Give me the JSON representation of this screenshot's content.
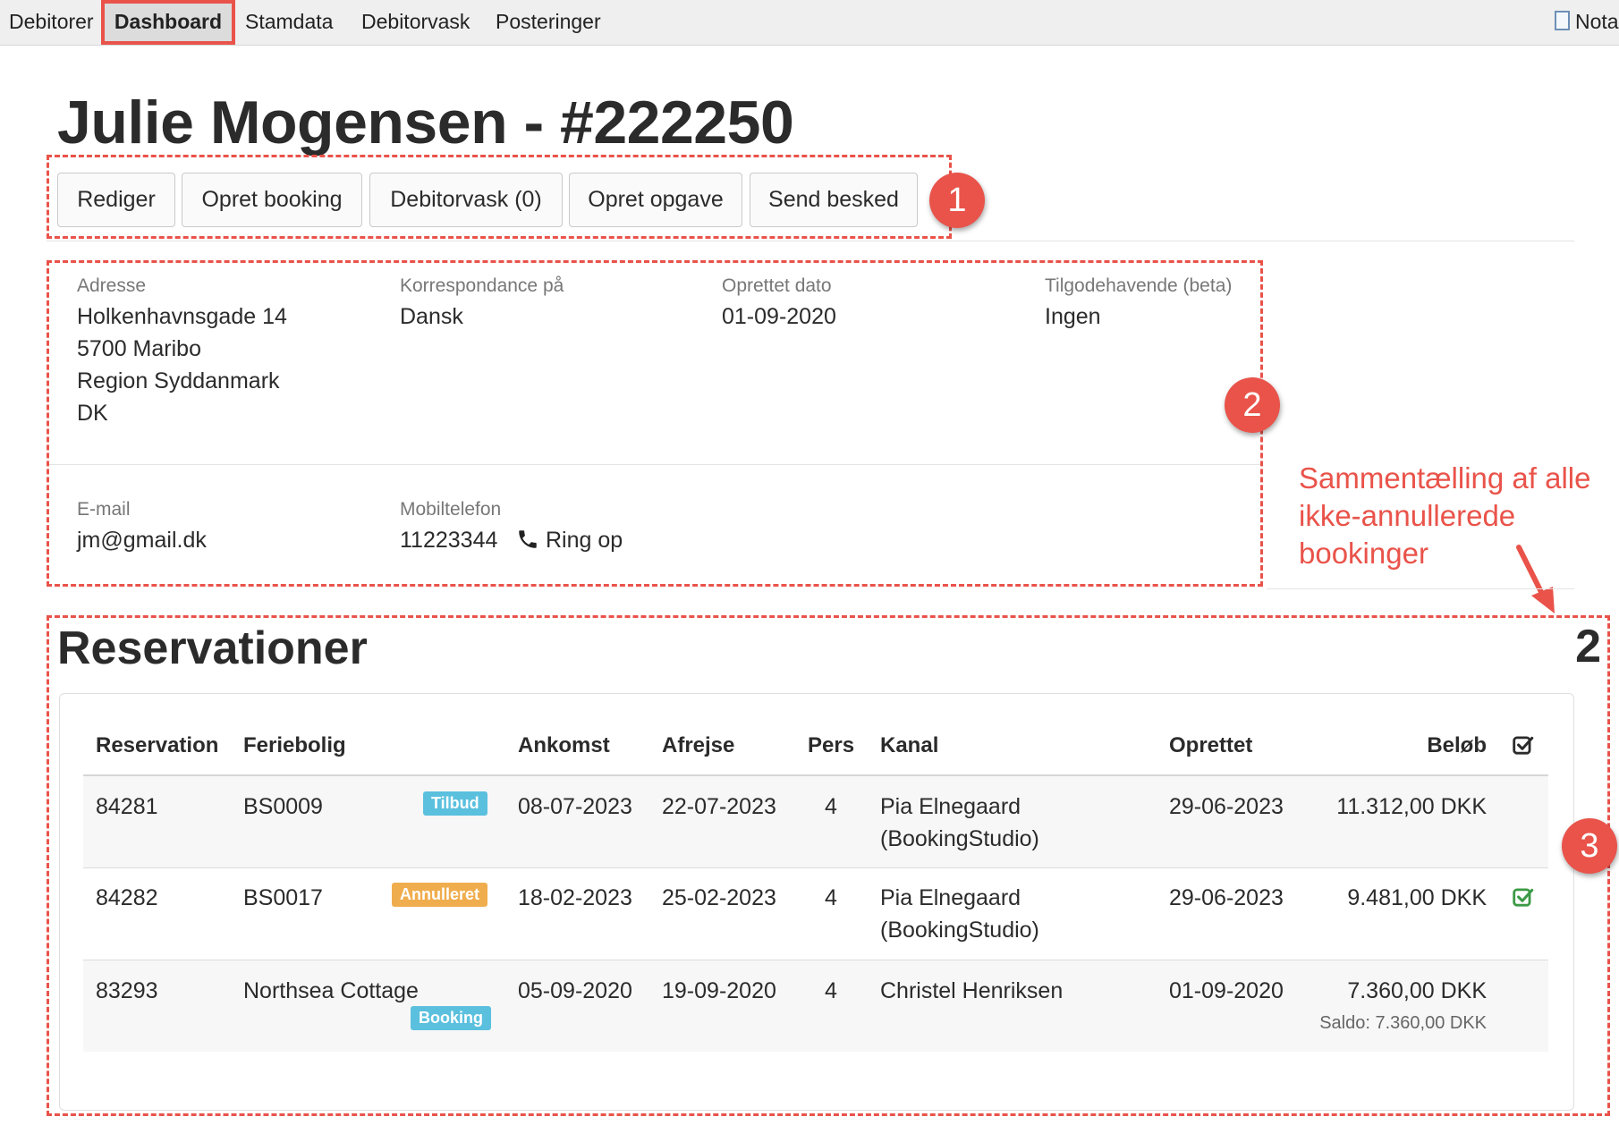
{
  "nav": {
    "items": [
      "Debitorer",
      "Dashboard",
      "Stamdata",
      "Debitorvask",
      "Posteringer"
    ],
    "nota": "Nota"
  },
  "title": "Julie Mogensen - #222250",
  "actions": [
    "Rediger",
    "Opret booking",
    "Debitorvask (0)",
    "Opret opgave",
    "Send besked"
  ],
  "callouts": [
    "1",
    "2",
    "3"
  ],
  "info": {
    "address": {
      "label": "Adresse",
      "lines": [
        "Holkenhavnsgade 14",
        "5700 Maribo",
        "Region Syddanmark",
        "DK"
      ]
    },
    "correspondence": {
      "label": "Korrespondance på",
      "value": "Dansk"
    },
    "created": {
      "label": "Oprettet dato",
      "value": "01-09-2020"
    },
    "receivable": {
      "label": "Tilgodehavende (beta)",
      "value": "Ingen"
    },
    "email": {
      "label": "E-mail",
      "value": "jm@gmail.dk"
    },
    "mobile": {
      "label": "Mobiltelefon",
      "value": "11223344",
      "call_label": "Ring op"
    }
  },
  "annotation": [
    "Sammentælling af alle",
    "ikke-annullerede",
    "bookinger"
  ],
  "reservations": {
    "title": "Reservationer",
    "count": "2",
    "columns": [
      "Reservation",
      "Feriebolig",
      "Ankomst",
      "Afrejse",
      "Pers",
      "Kanal",
      "Oprettet",
      "Beløb"
    ],
    "rows": [
      {
        "id": "84281",
        "property": "BS0009",
        "tag": "Tilbud",
        "arrival": "08-07-2023",
        "departure": "22-07-2023",
        "persons": "4",
        "channel": [
          "Pia Elnegaard",
          "(BookingStudio)"
        ],
        "created": "29-06-2023",
        "amount": "11.312,00 DKK"
      },
      {
        "id": "84282",
        "property": "BS0017",
        "tag": "Annulleret",
        "arrival": "18-02-2023",
        "departure": "25-02-2023",
        "persons": "4",
        "channel": [
          "Pia Elnegaard",
          "(BookingStudio)"
        ],
        "created": "29-06-2023",
        "amount": "9.481,00 DKK"
      },
      {
        "id": "83293",
        "property": "Northsea Cottage",
        "tag": "Booking",
        "arrival": "05-09-2020",
        "departure": "19-09-2020",
        "persons": "4",
        "channel": [
          "Christel Henriksen"
        ],
        "created": "01-09-2020",
        "amount": "7.360,00 DKK",
        "saldo": "Saldo: 7.360,00 DKK"
      }
    ]
  },
  "colors": {
    "accent_red": "#e9534a",
    "tag_tilbud": "#5bc0de",
    "tag_annulleret": "#f0ad4e",
    "tag_booking": "#5bc0de",
    "check_green": "#3c9a46"
  }
}
